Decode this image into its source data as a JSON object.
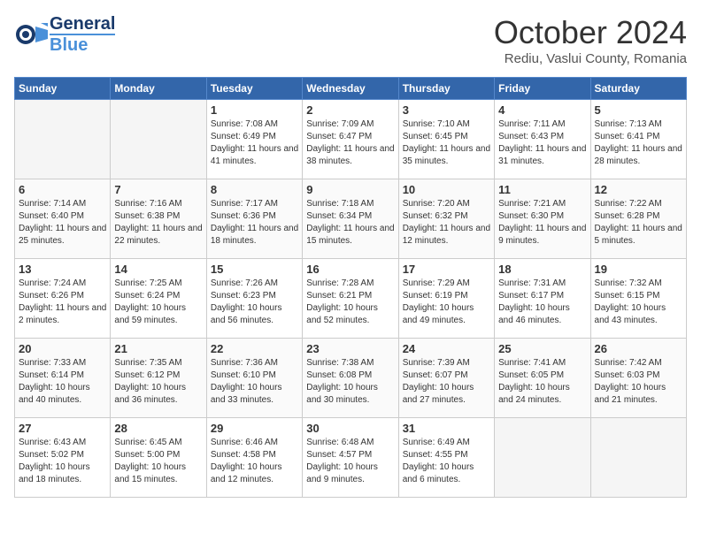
{
  "header": {
    "logo_line1": "General",
    "logo_line2": "Blue",
    "month": "October 2024",
    "location": "Rediu, Vaslui County, Romania"
  },
  "weekdays": [
    "Sunday",
    "Monday",
    "Tuesday",
    "Wednesday",
    "Thursday",
    "Friday",
    "Saturday"
  ],
  "weeks": [
    [
      {
        "day": "",
        "info": ""
      },
      {
        "day": "",
        "info": ""
      },
      {
        "day": "1",
        "info": "Sunrise: 7:08 AM\nSunset: 6:49 PM\nDaylight: 11 hours and 41 minutes."
      },
      {
        "day": "2",
        "info": "Sunrise: 7:09 AM\nSunset: 6:47 PM\nDaylight: 11 hours and 38 minutes."
      },
      {
        "day": "3",
        "info": "Sunrise: 7:10 AM\nSunset: 6:45 PM\nDaylight: 11 hours and 35 minutes."
      },
      {
        "day": "4",
        "info": "Sunrise: 7:11 AM\nSunset: 6:43 PM\nDaylight: 11 hours and 31 minutes."
      },
      {
        "day": "5",
        "info": "Sunrise: 7:13 AM\nSunset: 6:41 PM\nDaylight: 11 hours and 28 minutes."
      }
    ],
    [
      {
        "day": "6",
        "info": "Sunrise: 7:14 AM\nSunset: 6:40 PM\nDaylight: 11 hours and 25 minutes."
      },
      {
        "day": "7",
        "info": "Sunrise: 7:16 AM\nSunset: 6:38 PM\nDaylight: 11 hours and 22 minutes."
      },
      {
        "day": "8",
        "info": "Sunrise: 7:17 AM\nSunset: 6:36 PM\nDaylight: 11 hours and 18 minutes."
      },
      {
        "day": "9",
        "info": "Sunrise: 7:18 AM\nSunset: 6:34 PM\nDaylight: 11 hours and 15 minutes."
      },
      {
        "day": "10",
        "info": "Sunrise: 7:20 AM\nSunset: 6:32 PM\nDaylight: 11 hours and 12 minutes."
      },
      {
        "day": "11",
        "info": "Sunrise: 7:21 AM\nSunset: 6:30 PM\nDaylight: 11 hours and 9 minutes."
      },
      {
        "day": "12",
        "info": "Sunrise: 7:22 AM\nSunset: 6:28 PM\nDaylight: 11 hours and 5 minutes."
      }
    ],
    [
      {
        "day": "13",
        "info": "Sunrise: 7:24 AM\nSunset: 6:26 PM\nDaylight: 11 hours and 2 minutes."
      },
      {
        "day": "14",
        "info": "Sunrise: 7:25 AM\nSunset: 6:24 PM\nDaylight: 10 hours and 59 minutes."
      },
      {
        "day": "15",
        "info": "Sunrise: 7:26 AM\nSunset: 6:23 PM\nDaylight: 10 hours and 56 minutes."
      },
      {
        "day": "16",
        "info": "Sunrise: 7:28 AM\nSunset: 6:21 PM\nDaylight: 10 hours and 52 minutes."
      },
      {
        "day": "17",
        "info": "Sunrise: 7:29 AM\nSunset: 6:19 PM\nDaylight: 10 hours and 49 minutes."
      },
      {
        "day": "18",
        "info": "Sunrise: 7:31 AM\nSunset: 6:17 PM\nDaylight: 10 hours and 46 minutes."
      },
      {
        "day": "19",
        "info": "Sunrise: 7:32 AM\nSunset: 6:15 PM\nDaylight: 10 hours and 43 minutes."
      }
    ],
    [
      {
        "day": "20",
        "info": "Sunrise: 7:33 AM\nSunset: 6:14 PM\nDaylight: 10 hours and 40 minutes."
      },
      {
        "day": "21",
        "info": "Sunrise: 7:35 AM\nSunset: 6:12 PM\nDaylight: 10 hours and 36 minutes."
      },
      {
        "day": "22",
        "info": "Sunrise: 7:36 AM\nSunset: 6:10 PM\nDaylight: 10 hours and 33 minutes."
      },
      {
        "day": "23",
        "info": "Sunrise: 7:38 AM\nSunset: 6:08 PM\nDaylight: 10 hours and 30 minutes."
      },
      {
        "day": "24",
        "info": "Sunrise: 7:39 AM\nSunset: 6:07 PM\nDaylight: 10 hours and 27 minutes."
      },
      {
        "day": "25",
        "info": "Sunrise: 7:41 AM\nSunset: 6:05 PM\nDaylight: 10 hours and 24 minutes."
      },
      {
        "day": "26",
        "info": "Sunrise: 7:42 AM\nSunset: 6:03 PM\nDaylight: 10 hours and 21 minutes."
      }
    ],
    [
      {
        "day": "27",
        "info": "Sunrise: 6:43 AM\nSunset: 5:02 PM\nDaylight: 10 hours and 18 minutes."
      },
      {
        "day": "28",
        "info": "Sunrise: 6:45 AM\nSunset: 5:00 PM\nDaylight: 10 hours and 15 minutes."
      },
      {
        "day": "29",
        "info": "Sunrise: 6:46 AM\nSunset: 4:58 PM\nDaylight: 10 hours and 12 minutes."
      },
      {
        "day": "30",
        "info": "Sunrise: 6:48 AM\nSunset: 4:57 PM\nDaylight: 10 hours and 9 minutes."
      },
      {
        "day": "31",
        "info": "Sunrise: 6:49 AM\nSunset: 4:55 PM\nDaylight: 10 hours and 6 minutes."
      },
      {
        "day": "",
        "info": ""
      },
      {
        "day": "",
        "info": ""
      }
    ]
  ]
}
